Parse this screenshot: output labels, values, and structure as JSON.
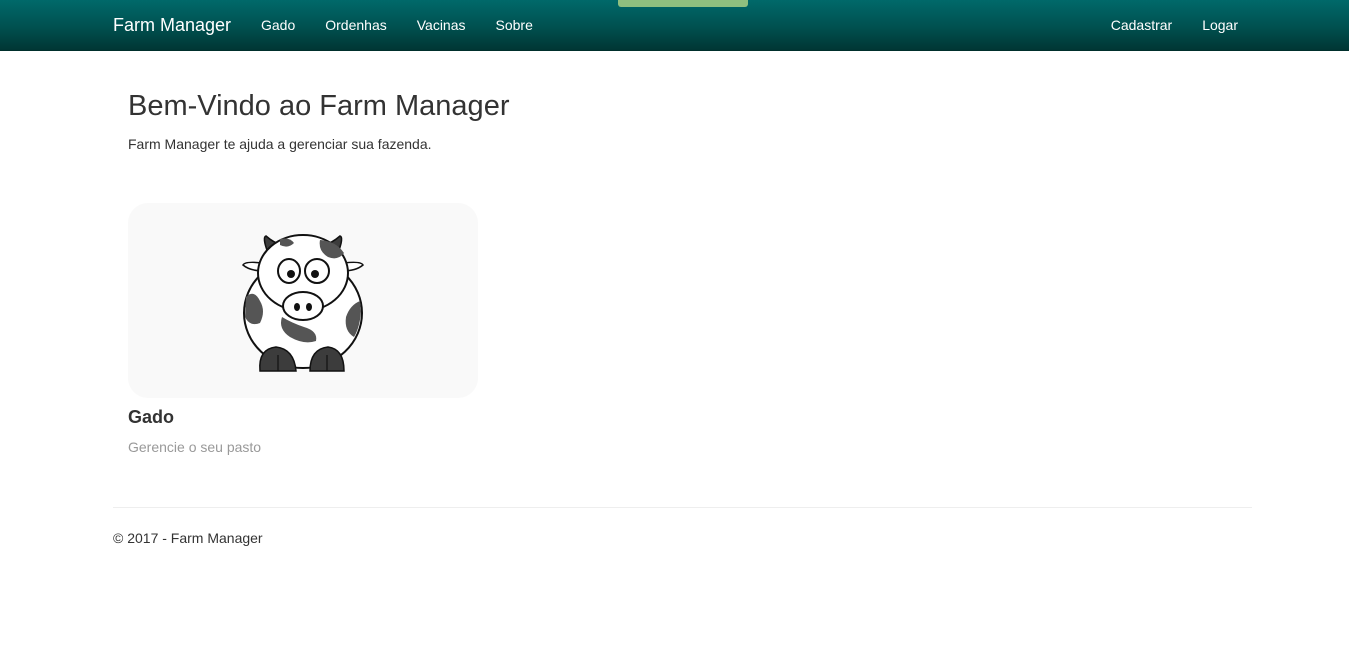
{
  "navbar": {
    "brand": "Farm Manager",
    "links": [
      {
        "label": "Gado"
      },
      {
        "label": "Ordenhas"
      },
      {
        "label": "Vacinas"
      },
      {
        "label": "Sobre"
      }
    ],
    "auth_links": [
      {
        "label": "Cadastrar"
      },
      {
        "label": "Logar"
      }
    ],
    "colors": {
      "gradient_top": "#00696a",
      "gradient_bottom": "#003634",
      "accent_tab": "#8fbf7f"
    }
  },
  "jumbotron": {
    "title": "Bem-Vindo ao Farm Manager",
    "lead": "Farm Manager te ajuda a gerenciar sua fazenda."
  },
  "cards": [
    {
      "icon": "cow-icon",
      "title": "Gado",
      "description": "Gerencie o seu pasto"
    }
  ],
  "footer": {
    "text": "© 2017 - Farm Manager"
  }
}
